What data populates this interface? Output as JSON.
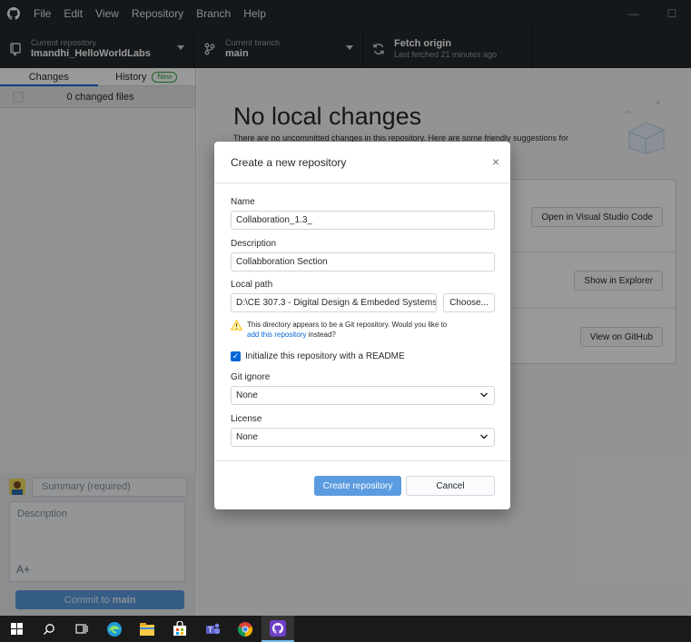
{
  "menubar": {
    "items": [
      "File",
      "Edit",
      "View",
      "Repository",
      "Branch",
      "Help"
    ],
    "window_controls": [
      "—",
      "☐"
    ]
  },
  "toolbar": {
    "repo": {
      "caption": "Current repository",
      "value": "Imandhi_HelloWorldLabs"
    },
    "branch": {
      "caption": "Current branch",
      "value": "main"
    },
    "fetch": {
      "caption": "Fetch origin",
      "value": "Last fetched 21 minutes ago"
    }
  },
  "sidebar": {
    "tabs": [
      {
        "label": "Changes"
      },
      {
        "label": "History",
        "badge": "New"
      }
    ],
    "changed_files": "0 changed files",
    "summary_placeholder": "Summary (required)",
    "description_placeholder": "Description",
    "coauthor_icon": "A+",
    "commit_prefix": "Commit to ",
    "commit_branch": "main"
  },
  "main": {
    "title": "No local changes",
    "subtitle": "There are no uncommitted changes in this repository. Here are some friendly suggestions for",
    "actions": [
      "Open in Visual Studio Code",
      "Show in Explorer",
      "View on GitHub"
    ]
  },
  "dialog": {
    "title": "Create a new repository",
    "close": "×",
    "name_label": "Name",
    "name_value": "Collaboration_1.3_",
    "description_label": "Description",
    "description_value": "Collabboration Section",
    "path_label": "Local path",
    "path_value": "D:\\CE 307.3 - Digital Design & Embeded Systems\\(",
    "choose_label": "Choose...",
    "warning_text": "This directory appears to be a Git repository. Would you like to",
    "warning_link": "add this repository",
    "warning_suffix": " instead?",
    "readme_label": "Initialize this repository with a README",
    "readme_checked": true,
    "gitignore_label": "Git ignore",
    "gitignore_value": "None",
    "license_label": "License",
    "license_value": "None",
    "create_label": "Create repository",
    "cancel_label": "Cancel"
  },
  "taskbar": {
    "apps": [
      "windows-start-icon",
      "search-icon",
      "task-view-icon",
      "edge-icon",
      "file-explorer-icon",
      "store-icon",
      "teams-icon",
      "chrome-icon",
      "github-desktop-icon"
    ]
  },
  "colors": {
    "accent": "#0366d6",
    "primary_button": "#5b9be0",
    "dark_bar": "#24292e"
  }
}
